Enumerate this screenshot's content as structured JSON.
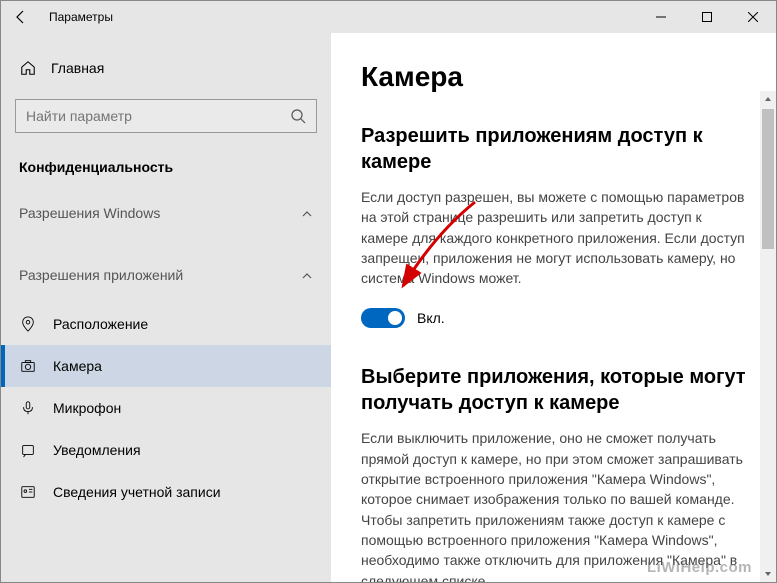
{
  "titlebar": {
    "title": "Параметры"
  },
  "sidebar": {
    "home": "Главная",
    "search_placeholder": "Найти параметр",
    "section": "Конфиденциальность",
    "group_windows": "Разрешения Windows",
    "group_apps": "Разрешения приложений",
    "items": [
      {
        "label": "Расположение"
      },
      {
        "label": "Камера"
      },
      {
        "label": "Микрофон"
      },
      {
        "label": "Уведомления"
      },
      {
        "label": "Сведения учетной записи"
      }
    ]
  },
  "content": {
    "title": "Камера",
    "h1": "Разрешить приложениям доступ к камере",
    "p1": "Если доступ разрешен, вы можете с помощью параметров на этой странице разрешить или запретить доступ к камере для каждого конкретного приложения. Если доступ запрещен, приложения не могут использовать камеру, но система Windows может.",
    "toggle_label": "Вкл.",
    "h2": "Выберите приложения, которые могут получать доступ к камере",
    "p2": "Если выключить приложение, оно не сможет получать прямой доступ к камере, но при этом сможет запрашивать открытие встроенного приложения \"Камера Windows\", которое снимает изображения только по вашей команде. Чтобы запретить приложениям также доступ к камере с помощью встроенного приложения \"Камера Windows\", необходимо также отключить для приложения \"Камера\" в следующем списке."
  },
  "watermark": "LiWiHelp.com"
}
